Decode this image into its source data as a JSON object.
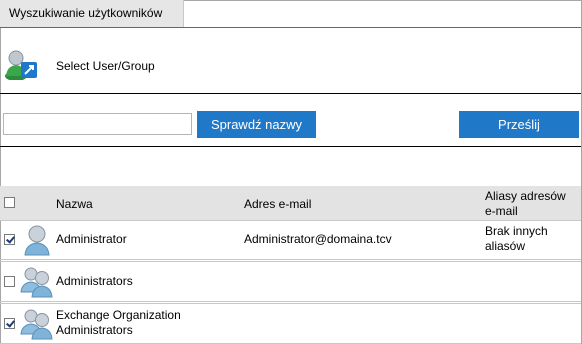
{
  "tab": {
    "label": "Wyszukiwanie użytkowników"
  },
  "header": {
    "label": "Select User/Group",
    "icon": "user-group-select-icon"
  },
  "search": {
    "value": "",
    "check_names_label": "Sprawdź nazwy",
    "submit_label": "Prześlij"
  },
  "table": {
    "columns": [
      "Nazwa",
      "Adres e-mail",
      "Aliasy adresów e-mail"
    ],
    "rows": [
      {
        "name": "Administrator",
        "email": "Administrator@domaina.tcv",
        "aliases": "Brak innych aliasów",
        "checked": true,
        "type": "user"
      },
      {
        "name": "Administrators",
        "email": "",
        "aliases": "",
        "checked": false,
        "type": "group"
      },
      {
        "name": "Exchange Organization Administrators",
        "email": "",
        "aliases": "",
        "checked": true,
        "type": "group"
      }
    ]
  },
  "colors": {
    "accent": "#1f78c8",
    "header_bg": "#e3e3e3",
    "tab_bg": "#e6e6e6"
  }
}
